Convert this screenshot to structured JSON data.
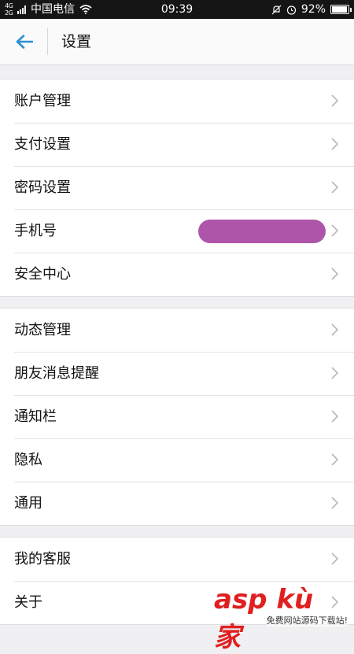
{
  "status_bar": {
    "network_type": "4G\n2G",
    "carrier": "中国电信",
    "time": "09:39",
    "battery": "92%"
  },
  "header": {
    "title": "设置"
  },
  "groups": [
    {
      "items": [
        {
          "label": "账户管理"
        },
        {
          "label": "支付设置"
        },
        {
          "label": "密码设置"
        },
        {
          "label": "手机号"
        },
        {
          "label": "安全中心"
        }
      ]
    },
    {
      "items": [
        {
          "label": "动态管理"
        },
        {
          "label": "朋友消息提醒"
        },
        {
          "label": "通知栏"
        },
        {
          "label": "隐私"
        },
        {
          "label": "通用"
        }
      ]
    },
    {
      "items": [
        {
          "label": "我的客服"
        },
        {
          "label": "关于"
        }
      ]
    }
  ],
  "watermark": {
    "logo": "asp kù 家",
    "subtitle": "免费网站源码下载站!"
  },
  "colors": {
    "accent": "#2b8fd6",
    "redaction": "#ad55a8",
    "watermark_red": "#e02020"
  }
}
